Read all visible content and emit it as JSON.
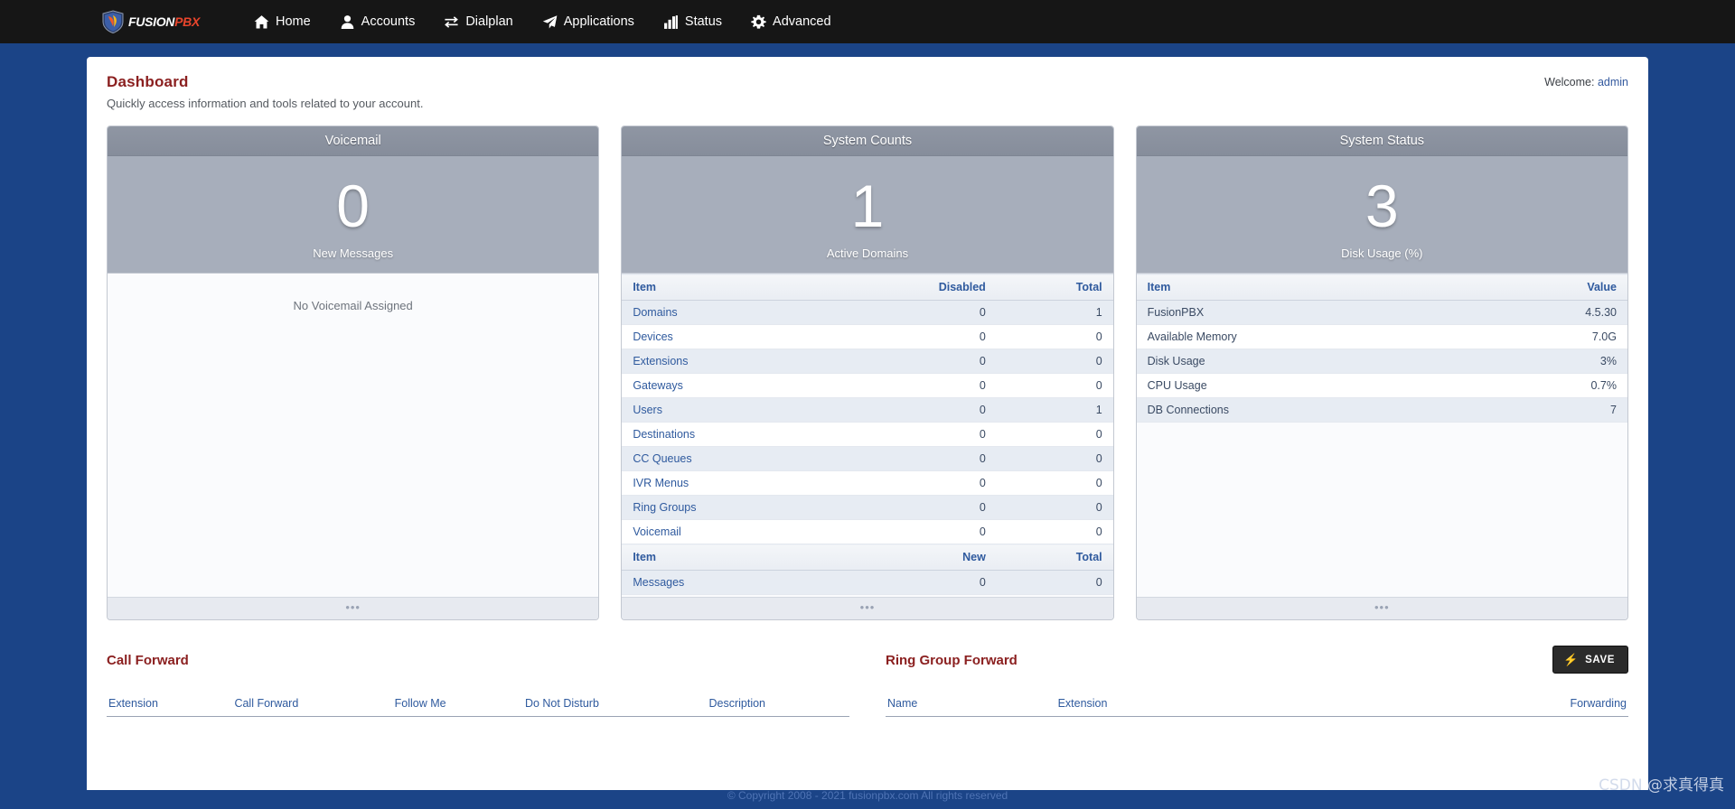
{
  "brand": {
    "name_white": "FUSION",
    "name_red": "PBX",
    "accent_red": "#e8452c",
    "title_red": "#8b2020",
    "link_blue": "#2f5a9e"
  },
  "nav": {
    "items": [
      {
        "label": "Home",
        "icon": "home-icon"
      },
      {
        "label": "Accounts",
        "icon": "user-icon"
      },
      {
        "label": "Dialplan",
        "icon": "exchange-arrows-icon"
      },
      {
        "label": "Applications",
        "icon": "paper-plane-icon"
      },
      {
        "label": "Status",
        "icon": "bar-chart-icon"
      },
      {
        "label": "Advanced",
        "icon": "gear-icon"
      }
    ]
  },
  "header": {
    "title": "Dashboard",
    "subtitle": "Quickly access information and tools related to your account.",
    "welcome_label": "Welcome:",
    "welcome_user": "admin"
  },
  "widgets": {
    "voicemail": {
      "title": "Voicemail",
      "hero_number": "0",
      "hero_label": "New Messages",
      "empty_text": "No Voicemail Assigned",
      "footer_dots": "•••"
    },
    "system_counts": {
      "title": "System Counts",
      "hero_number": "1",
      "hero_label": "Active Domains",
      "columns": [
        "Item",
        "Disabled",
        "Total"
      ],
      "rows": [
        {
          "item": "Domains",
          "disabled": "0",
          "total": "1"
        },
        {
          "item": "Devices",
          "disabled": "0",
          "total": "0"
        },
        {
          "item": "Extensions",
          "disabled": "0",
          "total": "0"
        },
        {
          "item": "Gateways",
          "disabled": "0",
          "total": "0"
        },
        {
          "item": "Users",
          "disabled": "0",
          "total": "1"
        },
        {
          "item": "Destinations",
          "disabled": "0",
          "total": "0"
        },
        {
          "item": "CC Queues",
          "disabled": "0",
          "total": "0"
        },
        {
          "item": "IVR Menus",
          "disabled": "0",
          "total": "0"
        },
        {
          "item": "Ring Groups",
          "disabled": "0",
          "total": "0"
        },
        {
          "item": "Voicemail",
          "disabled": "0",
          "total": "0"
        }
      ],
      "columns2": [
        "Item",
        "New",
        "Total"
      ],
      "rows2": [
        {
          "item": "Messages",
          "new": "0",
          "total": "0"
        }
      ],
      "footer_dots": "•••"
    },
    "system_status": {
      "title": "System Status",
      "hero_number": "3",
      "hero_label": "Disk Usage (%)",
      "columns": [
        "Item",
        "Value"
      ],
      "rows": [
        {
          "item": "FusionPBX",
          "value": "4.5.30"
        },
        {
          "item": "Available Memory",
          "value": "7.0G"
        },
        {
          "item": "Disk Usage",
          "value": "3%"
        },
        {
          "item": "CPU Usage",
          "value": "0.7%"
        },
        {
          "item": "DB Connections",
          "value": "7"
        }
      ],
      "footer_dots": "•••"
    }
  },
  "call_forward": {
    "title": "Call Forward",
    "columns": [
      "Extension",
      "Call Forward",
      "Follow Me",
      "Do Not Disturb",
      "Description"
    ]
  },
  "ring_group_forward": {
    "title": "Ring Group Forward",
    "columns": [
      "Name",
      "Extension",
      "Forwarding"
    ],
    "save_label": "SAVE",
    "save_icon": "lightning-bolt-icon"
  },
  "footer": {
    "copyright": "© Copyright 2008 - 2021 fusionpbx.com All rights reserved",
    "watermark": "CSDN @求真得真"
  }
}
